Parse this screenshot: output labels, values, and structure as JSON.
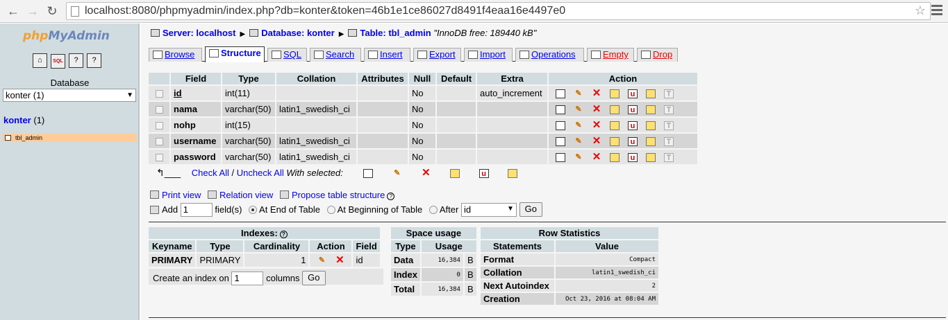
{
  "browser": {
    "url": "localhost:8080/phpmyadmin/index.php?db=konter&token=46b1e1ce86027d8491f4eaa16e4497e0"
  },
  "sidebar": {
    "logo_prefix": "php",
    "logo_suffix": "MyAdmin",
    "icon_home": "⌂",
    "icon_sql": "SQL",
    "database_label": "Database",
    "database_select": "konter (1)",
    "db_name": "konter",
    "db_count": "(1)",
    "table_item": "tbl_admin"
  },
  "breadcrumb": {
    "server": "Server: localhost",
    "database": "Database: konter",
    "table": "Table: tbl_admin",
    "note": "\"InnoDB free: 189440 kB\""
  },
  "tabs": [
    "Browse",
    "Structure",
    "SQL",
    "Search",
    "Insert",
    "Export",
    "Import",
    "Operations",
    "Empty",
    "Drop"
  ],
  "fields": {
    "headers": [
      "Field",
      "Type",
      "Collation",
      "Attributes",
      "Null",
      "Default",
      "Extra",
      "Action"
    ],
    "rows": [
      {
        "field": "id",
        "type": "int(11)",
        "collation": "",
        "attributes": "",
        "null": "No",
        "default": "",
        "extra": "auto_increment"
      },
      {
        "field": "nama",
        "type": "varchar(50)",
        "collation": "latin1_swedish_ci",
        "attributes": "",
        "null": "No",
        "default": "",
        "extra": ""
      },
      {
        "field": "nohp",
        "type": "int(15)",
        "collation": "",
        "attributes": "",
        "null": "No",
        "default": "",
        "extra": ""
      },
      {
        "field": "username",
        "type": "varchar(50)",
        "collation": "latin1_swedish_ci",
        "attributes": "",
        "null": "No",
        "default": "",
        "extra": ""
      },
      {
        "field": "password",
        "type": "varchar(50)",
        "collation": "latin1_swedish_ci",
        "attributes": "",
        "null": "No",
        "default": "",
        "extra": ""
      }
    ],
    "check_all": "Check All",
    "separator": "/",
    "uncheck_all": "Uncheck All",
    "with_selected": "With selected:"
  },
  "links": {
    "print_view": "Print view",
    "relation_view": "Relation view",
    "propose_structure": "Propose table structure"
  },
  "add_fields": {
    "add_label": "Add",
    "count": "1",
    "fields_label": "field(s)",
    "at_end": "At End of Table",
    "at_beginning": "At Beginning of Table",
    "after": "After",
    "after_select": "id",
    "go": "Go"
  },
  "indexes": {
    "title": "Indexes:",
    "headers": [
      "Keyname",
      "Type",
      "Cardinality",
      "Action",
      "Field"
    ],
    "row": {
      "keyname": "PRIMARY",
      "type": "PRIMARY",
      "cardinality": "1",
      "field": "id"
    },
    "create_label": "Create an index on",
    "create_count": "1",
    "columns_label": "columns",
    "go": "Go"
  },
  "space_usage": {
    "title": "Space usage",
    "headers": [
      "Type",
      "Usage"
    ],
    "rows": [
      {
        "type": "Data",
        "value": "16,384",
        "unit": "B"
      },
      {
        "type": "Index",
        "value": "0",
        "unit": "B"
      },
      {
        "type": "Total",
        "value": "16,384",
        "unit": "B"
      }
    ]
  },
  "row_statistics": {
    "title": "Row Statistics",
    "headers": [
      "Statements",
      "Value"
    ],
    "rows": [
      {
        "statement": "Format",
        "value": "Compact"
      },
      {
        "statement": "Collation",
        "value": "latin1_swedish_ci"
      },
      {
        "statement": "Next Autoindex",
        "value": "2"
      },
      {
        "statement": "Creation",
        "value": "Oct 23, 2016 at 08:04 AM"
      }
    ]
  },
  "icons": {
    "browse": "browse-icon",
    "edit": "pencil-icon",
    "drop": "delete-icon",
    "primary": "primary-key-icon",
    "unique": "unique-icon",
    "index": "index-icon",
    "fulltext": "fulltext-icon"
  }
}
